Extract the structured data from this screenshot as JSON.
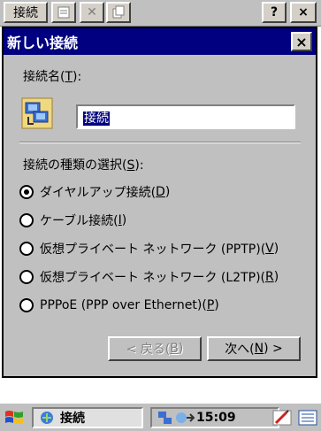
{
  "toolbar": {
    "connect_label": "接続",
    "help_label": "?",
    "close_label": "×"
  },
  "dialog": {
    "title": "新しい接続",
    "close_label": "×",
    "name_label_prefix": "接続名(",
    "name_label_key": "T",
    "name_label_suffix": "):",
    "name_value": "接続",
    "type_label_prefix": "接続の種類の選択(",
    "type_label_key": "S",
    "type_label_suffix": "):",
    "options": [
      {
        "pre": "ダイヤルアップ接続(",
        "key": "D",
        "post": ")",
        "checked": true
      },
      {
        "pre": "ケーブル接続(",
        "key": "I",
        "post": ")",
        "checked": false
      },
      {
        "pre": "仮想プライベート ネットワーク (PPTP)(",
        "key": "V",
        "post": ")",
        "checked": false
      },
      {
        "pre": "仮想プライベート ネットワーク (L2TP)(",
        "key": "R",
        "post": ")",
        "checked": false
      },
      {
        "pre": "PPPoE (PPP over Ethernet)(",
        "key": "P",
        "post": ")",
        "checked": false
      }
    ],
    "back_button": {
      "pre": "< 戻る(",
      "key": "B",
      "post": ")"
    },
    "next_button": {
      "pre": "次へ(",
      "key": "N",
      "post": ") >"
    }
  },
  "taskbar": {
    "task_label": "接続",
    "clock": "15:09"
  },
  "colors": {
    "titlebar": "#000080",
    "face": "#c0c0c0",
    "selection": "#000080"
  },
  "icons": [
    "start-flag-icon",
    "connection-icon",
    "network-icon",
    "pen-icon",
    "keyboard-icon"
  ]
}
